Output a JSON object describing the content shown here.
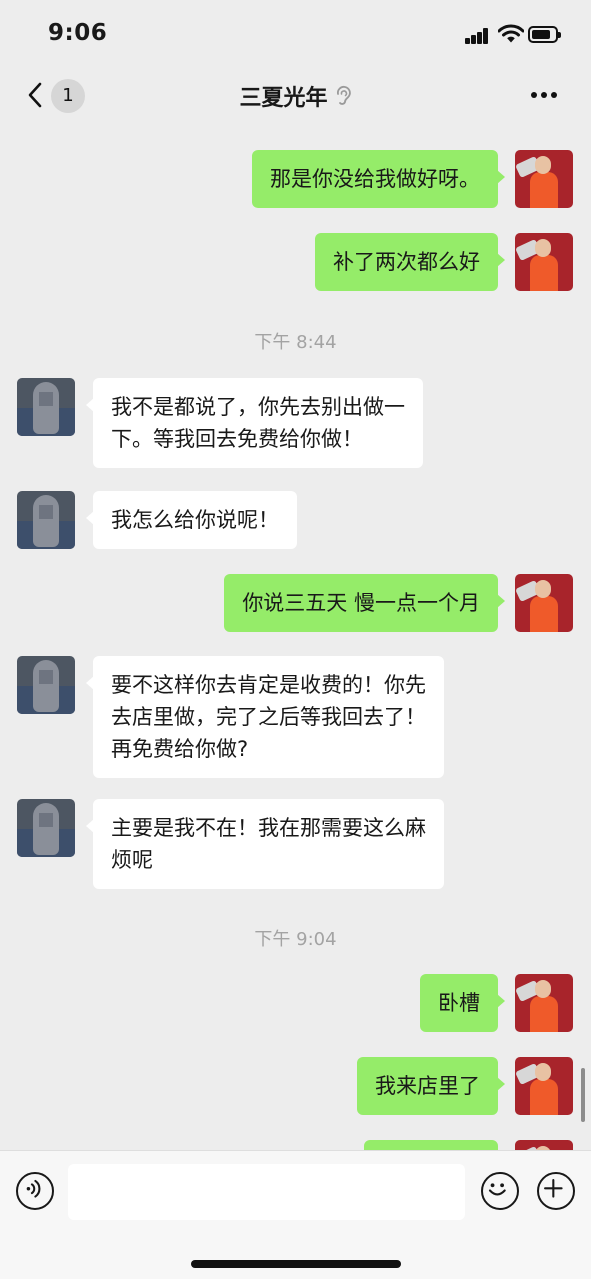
{
  "status_bar": {
    "time": "9:06"
  },
  "nav": {
    "back_count": "1",
    "title": "三夏光年"
  },
  "messages": [
    {
      "from": "me",
      "text": "那是你没给我做好呀。"
    },
    {
      "from": "me",
      "text": "补了两次都么好"
    },
    {
      "type": "time",
      "text": "下午 8:44"
    },
    {
      "from": "other",
      "line1": "我不是都说了，你先去别出做一",
      "line2": "下。等我回去免费给你做！"
    },
    {
      "from": "other",
      "text": "我怎么给你说呢！"
    },
    {
      "from": "me",
      "text": "你说三五天 慢一点一个月"
    },
    {
      "from": "other",
      "line1": "要不这样你去肯定是收费的！你先",
      "line2": "去店里做，完了之后等我回去了！",
      "line3": "再免费给你做?"
    },
    {
      "from": "other",
      "line1": "主要是我不在！我在那需要这么麻",
      "line2": "烦呢"
    },
    {
      "type": "time",
      "text": "下午 9:04"
    },
    {
      "from": "me",
      "text": "卧槽"
    },
    {
      "from": "me",
      "text": "我来店里了"
    }
  ],
  "input": {
    "value": ""
  },
  "icons": [
    "back-chevron-icon",
    "ear-icon",
    "more-icon",
    "voice-icon",
    "emoji-icon",
    "plus-icon"
  ],
  "colors": {
    "me_bubble": "#95ec69",
    "other_bubble": "#ffffff",
    "background": "#ededed"
  }
}
